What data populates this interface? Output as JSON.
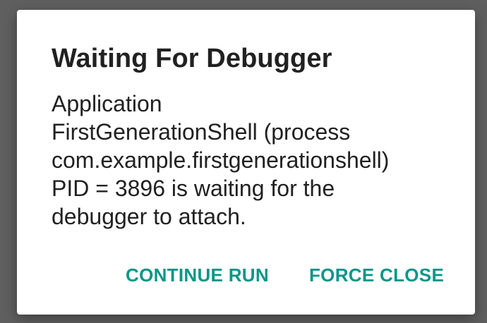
{
  "dialog": {
    "title": "Waiting For Debugger",
    "message_lines": [
      "Application",
      "FirstGenerationShell (process",
      "com.example.firstgenerationshell)",
      "PID = 3896 is waiting for the",
      "debugger to attach."
    ],
    "buttons": {
      "continue_label": "CONTINUE RUN",
      "force_close_label": "FORCE CLOSE"
    }
  },
  "colors": {
    "scrim": "#5f5f5f",
    "surface": "#ffffff",
    "text_primary": "#212121",
    "accent": "#0a9688"
  }
}
